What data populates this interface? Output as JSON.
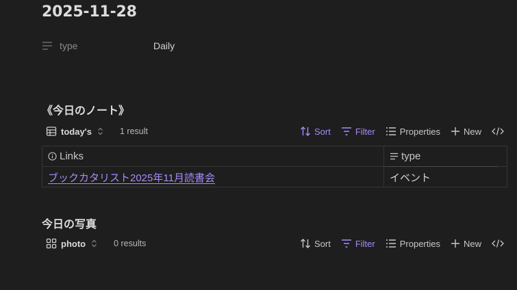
{
  "page": {
    "title": "2025-11-28",
    "property": {
      "key": "type",
      "value": "Daily",
      "icon": "text-lines-icon"
    }
  },
  "notes_section": {
    "title": "《今日のノート》",
    "toolbar": {
      "view_name": "today's",
      "view_icon": "table-icon",
      "count": "1 result",
      "sort_label": "Sort",
      "filter_label": "Filter",
      "properties_label": "Properties",
      "new_label": "New"
    },
    "table": {
      "columns": [
        {
          "label": "Links",
          "icon": "info-icon"
        },
        {
          "label": "type",
          "icon": "text-lines-icon"
        }
      ],
      "rows": [
        {
          "link": "ブックカタリスト2025年11月読書会",
          "type": "イベント"
        }
      ]
    }
  },
  "photo_section": {
    "title": "今日の写真",
    "toolbar": {
      "view_name": "photo",
      "view_icon": "grid-icon",
      "count": "0 results",
      "sort_label": "Sort",
      "filter_label": "Filter",
      "properties_label": "Properties",
      "new_label": "New"
    }
  },
  "colors": {
    "background": "#1e1e1e",
    "accent": "#a88bfa",
    "text": "#dadada",
    "muted": "#8a8a8a"
  }
}
